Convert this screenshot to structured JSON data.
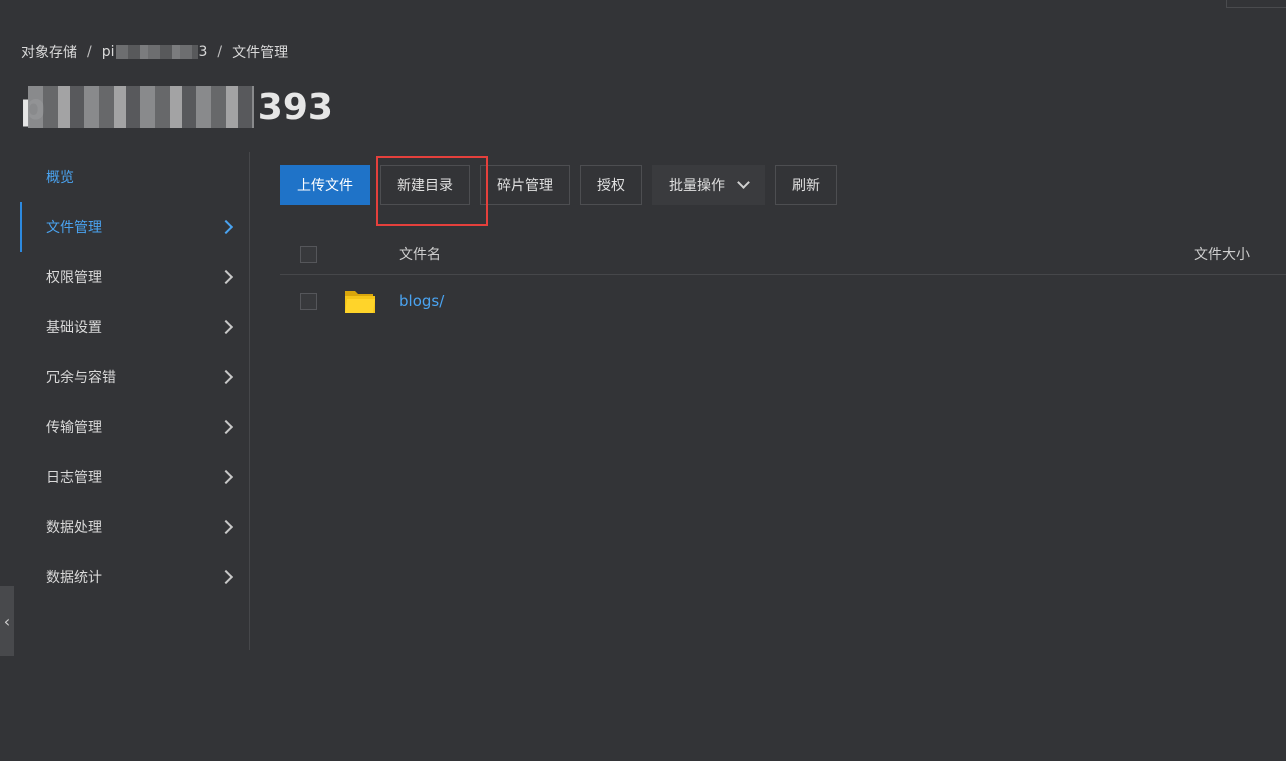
{
  "breadcrumb": {
    "root": "对象存储",
    "sep": "/",
    "bucket_prefix": "pi",
    "bucket_suffix": "3",
    "current": "文件管理"
  },
  "title": {
    "suffix": "393",
    "prefix": "p"
  },
  "sidebar": {
    "items": [
      {
        "label": "概览"
      },
      {
        "label": "文件管理"
      },
      {
        "label": "权限管理"
      },
      {
        "label": "基础设置"
      },
      {
        "label": "冗余与容错"
      },
      {
        "label": "传输管理"
      },
      {
        "label": "日志管理"
      },
      {
        "label": "数据处理"
      },
      {
        "label": "数据统计"
      }
    ],
    "collapse_glyph": "‹"
  },
  "toolbar": {
    "upload": "上传文件",
    "new_dir": "新建目录",
    "fragments": "碎片管理",
    "authorize": "授权",
    "batch": "批量操作",
    "refresh": "刷新"
  },
  "table": {
    "col_name": "文件名",
    "col_size": "文件大小",
    "rows": [
      {
        "name": "blogs/"
      }
    ]
  },
  "colors": {
    "accent": "#1f73c8",
    "link": "#4aa3f0",
    "highlight": "#e5403c",
    "folder": "#f5c518"
  }
}
